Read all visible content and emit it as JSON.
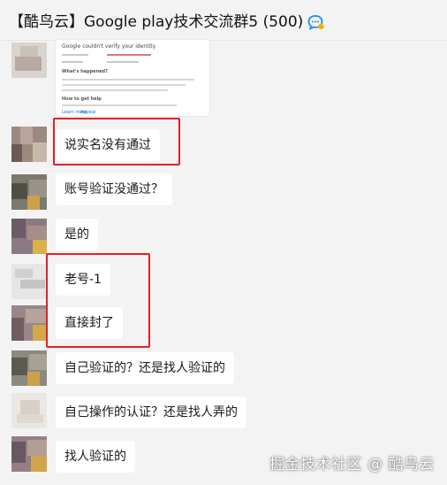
{
  "header": {
    "title": "【酷鸟云】Google play技术交流群5 (500)",
    "icon": "group-chat-icon"
  },
  "screenshot_card": {
    "heading": "Google couldn't verify your identity",
    "whats_happened": "What's happened?",
    "how_to_get_help": "How to get help",
    "link_1": "Learn more",
    "link_2": "Appeal"
  },
  "messages": [
    {
      "text": "说实名没有通过"
    },
    {
      "text": "账号验证没通过？"
    },
    {
      "text": "是的"
    },
    {
      "text": "老号-1"
    },
    {
      "text": "直接封了"
    },
    {
      "text": "自己验证的？还是找人验证的"
    },
    {
      "text": "自己操作的认证？还是找人弄的"
    },
    {
      "text": "找人验证的"
    }
  ],
  "watermark": "掘金技术社区 @ 酷鸟云",
  "colors": {
    "background": "#f3f3f3",
    "bubble": "#ffffff",
    "highlight_box": "#e0212a",
    "group_icon_blue": "#1d8cf0"
  }
}
